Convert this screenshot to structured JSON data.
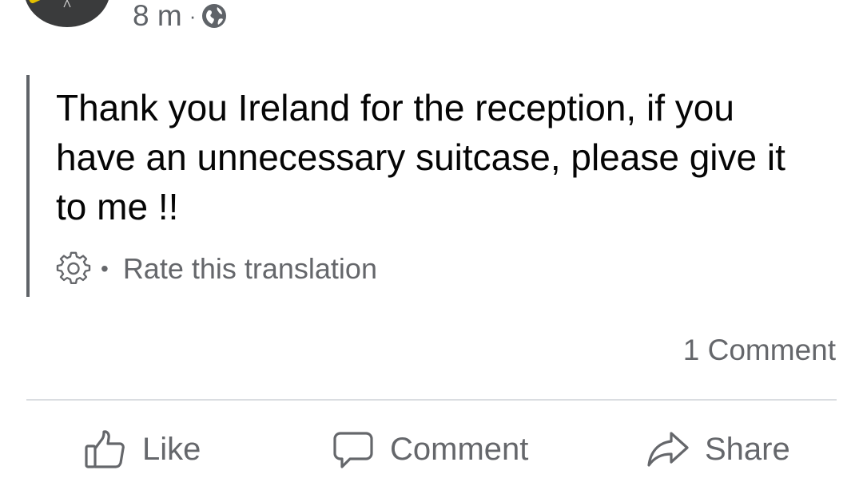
{
  "post": {
    "timestamp": "8 m",
    "separator": "·",
    "privacy_icon": "globe-icon",
    "text": "Thank you Ireland for the reception, if you have an unnecessary suitcase, please give it to me !!",
    "translation": {
      "settings_icon": "gear-icon",
      "separator": "•",
      "rate_label": "Rate this translation"
    },
    "comment_count": "1 Comment"
  },
  "actions": {
    "like": {
      "label": "Like",
      "icon": "thumbs-up-icon"
    },
    "comment": {
      "label": "Comment",
      "icon": "speech-bubble-icon"
    },
    "share": {
      "label": "Share",
      "icon": "share-arrow-icon"
    }
  },
  "colors": {
    "text_primary": "#050505",
    "text_secondary": "#65676b",
    "divider": "#dadde1"
  }
}
